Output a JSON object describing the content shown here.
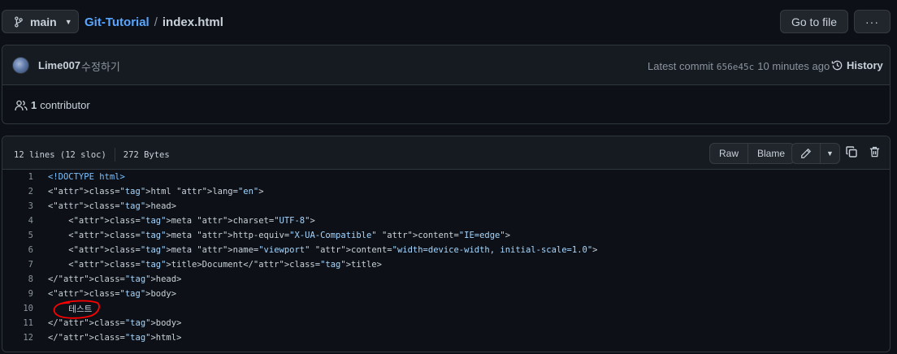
{
  "top": {
    "branch": "main",
    "repo": "Git-Tutorial",
    "separator": "/",
    "file": "index.html",
    "goto_label": "Go to file",
    "more_label": "···"
  },
  "commit": {
    "author": "Lime007",
    "message": "수정하기",
    "latest_label": "Latest commit",
    "sha": "656e45c",
    "time": "10 minutes ago",
    "history_label": "History",
    "contributors_count": "1",
    "contributors_label": "contributor"
  },
  "file": {
    "lines_info": "12 lines (12 sloc)",
    "size": "272 Bytes",
    "raw_label": "Raw",
    "blame_label": "Blame"
  },
  "code": [
    {
      "n": "1",
      "text": "<!DOCTYPE html>"
    },
    {
      "n": "2",
      "text": "<html lang=\"en\">"
    },
    {
      "n": "3",
      "text": "<head>"
    },
    {
      "n": "4",
      "text": "    <meta charset=\"UTF-8\">"
    },
    {
      "n": "5",
      "text": "    <meta http-equiv=\"X-UA-Compatible\" content=\"IE=edge\">"
    },
    {
      "n": "6",
      "text": "    <meta name=\"viewport\" content=\"width=device-width, initial-scale=1.0\">"
    },
    {
      "n": "7",
      "text": "    <title>Document</title>"
    },
    {
      "n": "8",
      "text": "</head>"
    },
    {
      "n": "9",
      "text": "<body>"
    },
    {
      "n": "10",
      "text": "    테스트"
    },
    {
      "n": "11",
      "text": "</body>"
    },
    {
      "n": "12",
      "text": "</html>"
    }
  ],
  "colors": {
    "background": "#0d1117",
    "link": "#58a6ff",
    "tag": "#7ee787",
    "attr": "#79c0ff",
    "string": "#a5d6ff",
    "annotation": "#ff0000"
  }
}
